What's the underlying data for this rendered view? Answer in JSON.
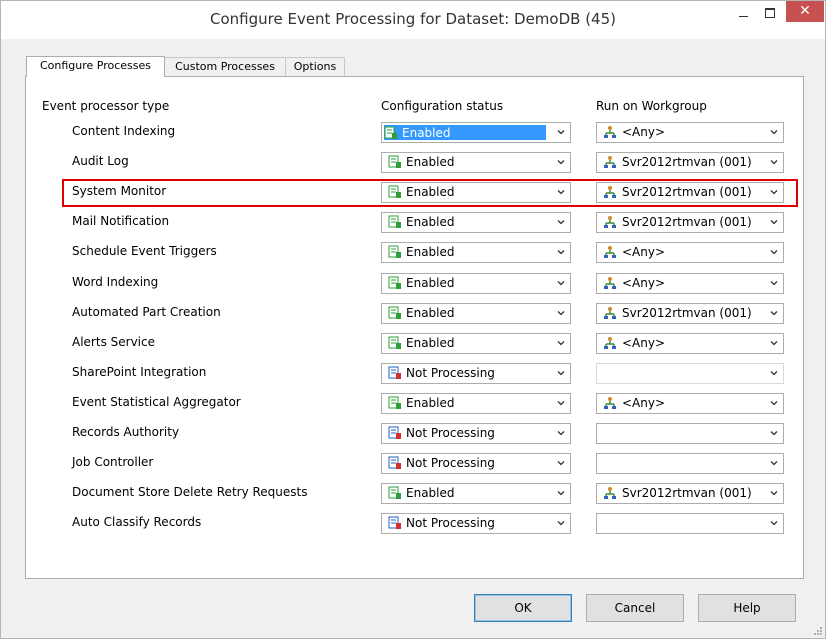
{
  "window": {
    "title": "Configure Event Processing for Dataset: DemoDB (45)",
    "close_glyph": "✕"
  },
  "tabs": [
    {
      "label": "Configure Processes",
      "active": true
    },
    {
      "label": "Custom Processes",
      "active": false
    },
    {
      "label": "Options",
      "active": false
    }
  ],
  "columns": {
    "type": "Event processor type",
    "status": "Configuration status",
    "workgroup": "Run on Workgroup"
  },
  "rows": [
    {
      "label": "Content Indexing",
      "status": "Enabled",
      "workgroup": "<Any>",
      "selected": true
    },
    {
      "label": "Audit Log",
      "status": "Enabled",
      "workgroup": "Svr2012rtmvan (001)"
    },
    {
      "label": "System Monitor",
      "status": "Enabled",
      "workgroup": "Svr2012rtmvan (001)",
      "highlighted": true
    },
    {
      "label": "Mail Notification",
      "status": "Enabled",
      "workgroup": "Svr2012rtmvan (001)"
    },
    {
      "label": "Schedule Event Triggers",
      "status": "Enabled",
      "workgroup": "<Any>"
    },
    {
      "label": "Word Indexing",
      "status": "Enabled",
      "workgroup": "<Any>"
    },
    {
      "label": "Automated Part Creation",
      "status": "Enabled",
      "workgroup": "Svr2012rtmvan (001)"
    },
    {
      "label": "Alerts Service",
      "status": "Enabled",
      "workgroup": "<Any>"
    },
    {
      "label": "SharePoint Integration",
      "status": "Not Processing",
      "workgroup": "",
      "workgroup_disabled": true
    },
    {
      "label": "Event Statistical Aggregator",
      "status": "Enabled",
      "workgroup": "<Any>"
    },
    {
      "label": "Records Authority",
      "status": "Not Processing",
      "workgroup": ""
    },
    {
      "label": "Job Controller",
      "status": "Not Processing",
      "workgroup": ""
    },
    {
      "label": "Document Store Delete Retry Requests",
      "status": "Enabled",
      "workgroup": "Svr2012rtmvan (001)"
    },
    {
      "label": "Auto Classify Records",
      "status": "Not Processing",
      "workgroup": ""
    }
  ],
  "buttons": {
    "ok": "OK",
    "cancel": "Cancel",
    "help": "Help"
  },
  "colors": {
    "highlight_border": "#e00000",
    "selection": "#3399ff",
    "enabled_icon": "#2e9d3a",
    "not_processing_icon": "#2060c0",
    "close_button": "#c75050"
  },
  "icons": {
    "status_enabled": "enabled-status-icon",
    "status_not_processing": "not-processing-status-icon",
    "workgroup": "workgroup-icon",
    "dropdown": "chevron-down-icon"
  }
}
